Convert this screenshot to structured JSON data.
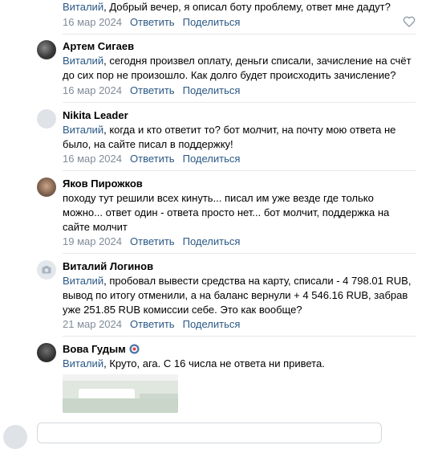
{
  "actions": {
    "reply": "Ответить",
    "share": "Поделиться"
  },
  "comments": [
    {
      "author": "",
      "reply_to": "Виталий",
      "text": ", Добрый вечер, я описал боту проблему, ответ мне дадут?",
      "date": "16 мар 2024"
    },
    {
      "author": "Артем Сигаев",
      "reply_to": "Виталий",
      "text": ", сегодня произвел оплату, деньги списали, зачисление на счёт до сих пор не произошло. Как долго будет происходить зачисление?",
      "date": "16 мар 2024"
    },
    {
      "author": "Nikita Leader",
      "reply_to": "Виталий",
      "text": ", когда и кто ответит то? бот молчит, на почту мою ответа не было, на сайте писал в поддержку!",
      "date": "16 мар 2024"
    },
    {
      "author": "Яков Пирожков",
      "reply_to": "",
      "text": "походу тут решили всех кинуть... писал им уже везде где только можно... ответ один - ответа просто нет... бот молчит, поддержка на сайте молчит",
      "date": "19 мар 2024"
    },
    {
      "author": "Виталий Логинов",
      "reply_to": "Виталий",
      "text": ", пробовал вывести средства на карту, списали - 4 798.01 RUB, вывод по итогу отменили, а на баланс вернули + 4 546.16 RUB, забрав уже 251.85 RUB комиссии себе. Это как вообще?",
      "date": "21 мар 2024"
    },
    {
      "author": "Вова Гудым",
      "reply_to": "Виталий",
      "text": ", Круто, ага. С 16 числа не ответа ни привета.",
      "date": ""
    }
  ],
  "icons": {
    "like": "heart-icon",
    "badge": "vk-badge-icon",
    "camera": "camera-icon"
  },
  "colors": {
    "link": "#2a5885",
    "meta": "#818c99",
    "divider": "#e7e8ec"
  }
}
